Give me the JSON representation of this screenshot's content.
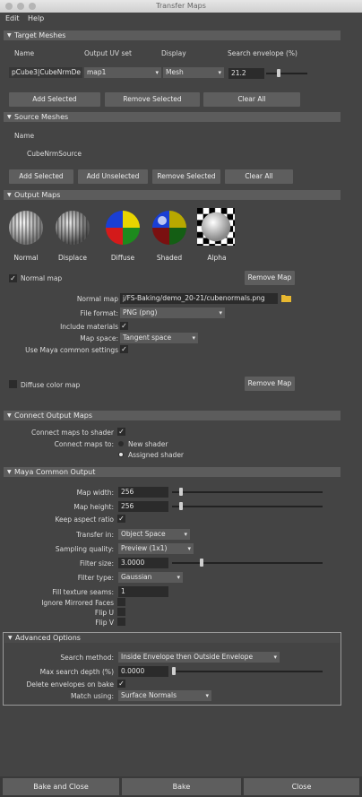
{
  "window": {
    "title": "Transfer Maps"
  },
  "menu": {
    "edit": "Edit",
    "help": "Help"
  },
  "target_meshes": {
    "header": "Target Meshes",
    "col_name": "Name",
    "col_uv": "Output UV set",
    "col_display": "Display",
    "col_envelope": "Search envelope (%)",
    "row_name": "pCube3|CubeNrmDe",
    "row_uv": "map1",
    "row_display": "Mesh",
    "row_envelope": "21.2",
    "add_selected": "Add Selected",
    "remove_selected": "Remove Selected",
    "clear_all": "Clear All"
  },
  "source_meshes": {
    "header": "Source Meshes",
    "col_name": "Name",
    "row_name": "CubeNrmSource",
    "add_selected": "Add Selected",
    "add_unselected": "Add Unselected",
    "remove_selected": "Remove Selected",
    "clear_all": "Clear All"
  },
  "output_maps": {
    "header": "Output Maps",
    "icons": [
      {
        "label": "Normal",
        "icon": "normal-map-sphere-icon"
      },
      {
        "label": "Displace",
        "icon": "displace-map-sphere-icon"
      },
      {
        "label": "Diffuse",
        "icon": "diffuse-map-sphere-icon"
      },
      {
        "label": "Shaded",
        "icon": "shaded-map-sphere-icon"
      },
      {
        "label": "Alpha",
        "icon": "alpha-map-sphere-icon"
      }
    ],
    "normal_map_toggle": "Normal map",
    "remove_map": "Remove Map",
    "normal_map_label": "Normal map",
    "normal_map_path": "j/FS-Baking/demo_20-21/cubenormals.png",
    "file_format_label": "File format:",
    "file_format_value": "PNG (png)",
    "include_materials_label": "Include materials",
    "map_space_label": "Map space:",
    "map_space_value": "Tangent space",
    "use_maya_common_label": "Use Maya common settings",
    "diffuse_color_map": "Diffuse color map",
    "remove_map_2": "Remove Map"
  },
  "connect_output_maps": {
    "header": "Connect Output Maps",
    "connect_to_shader_label": "Connect maps to shader",
    "connect_to_label": "Connect maps to:",
    "new_shader": "New shader",
    "assigned_shader": "Assigned shader"
  },
  "maya_common_output": {
    "header": "Maya Common Output",
    "map_width_label": "Map width:",
    "map_width_value": "256",
    "map_height_label": "Map height:",
    "map_height_value": "256",
    "keep_aspect_label": "Keep aspect ratio",
    "transfer_in_label": "Transfer in:",
    "transfer_in_value": "Object Space",
    "sampling_quality_label": "Sampling quality:",
    "sampling_quality_value": "Preview (1x1)",
    "filter_size_label": "Filter size:",
    "filter_size_value": "3.0000",
    "filter_type_label": "Filter type:",
    "filter_type_value": "Gaussian",
    "fill_seams_label": "Fill texture seams:",
    "fill_seams_value": "1",
    "ignore_mirrored_label": "Ignore Mirrored Faces",
    "flip_u_label": "Flip U",
    "flip_v_label": "Flip V"
  },
  "advanced_options": {
    "header": "Advanced Options",
    "search_method_label": "Search method:",
    "search_method_value": "Inside Envelope then Outside Envelope",
    "max_depth_label": "Max search depth (%)",
    "max_depth_value": "0.0000",
    "delete_envelopes_label": "Delete envelopes on bake",
    "match_using_label": "Match using:",
    "match_using_value": "Surface Normals"
  },
  "footer": {
    "bake_and_close": "Bake and Close",
    "bake": "Bake",
    "close": "Close"
  }
}
